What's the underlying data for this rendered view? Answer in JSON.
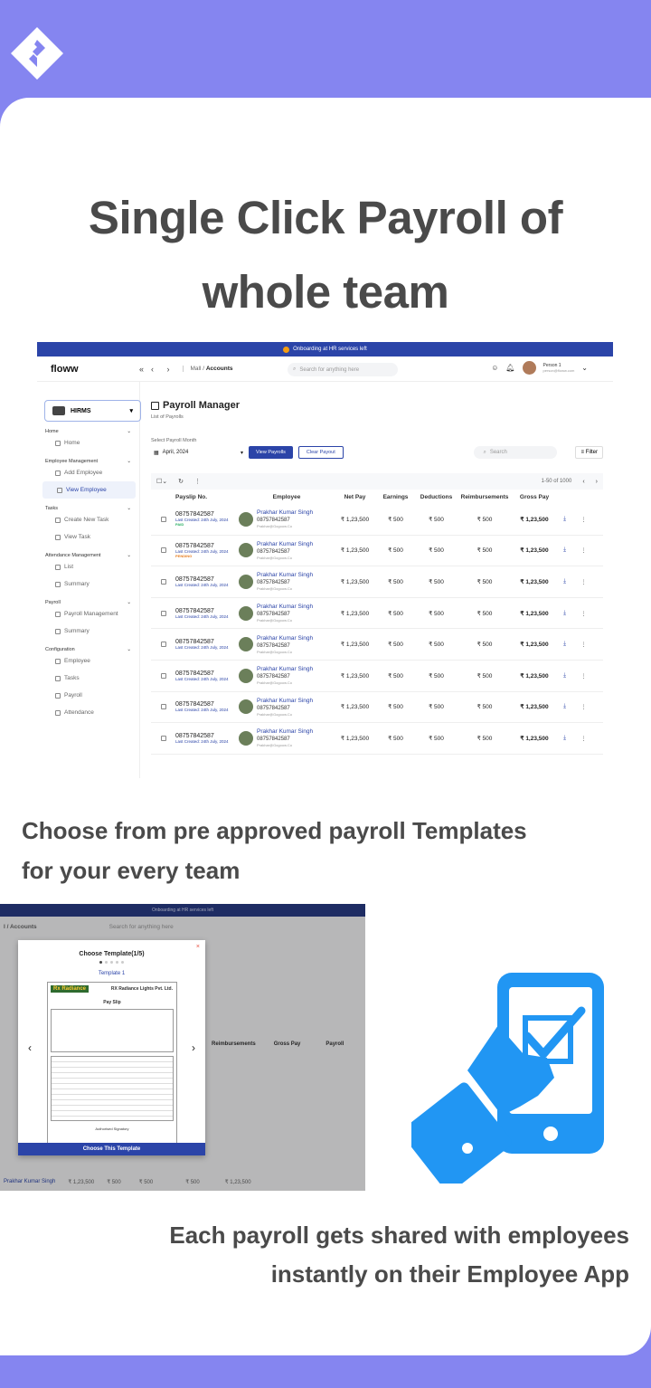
{
  "headline": {
    "line1": "Single Click Payroll of",
    "line2": "whole team"
  },
  "app": {
    "banner": "Onboarding at HR services left",
    "brand": "floww",
    "collapse_icon": "«",
    "nav_arrows": "‹ ›",
    "breadcrumb_prefix": "Mall /",
    "breadcrumb_current": "Accounts",
    "search_placeholder": "Search for anything here",
    "user_name": "Person 1",
    "user_email": "person@floww.com",
    "org": "HIRMS",
    "sidebar": {
      "sections": [
        {
          "title": "Home",
          "items": [
            "Home"
          ]
        },
        {
          "title": "Employee Management",
          "items": [
            "Add Employee",
            "View Employee"
          ]
        },
        {
          "title": "Tasks",
          "items": [
            "Create New Task",
            "View Task"
          ]
        },
        {
          "title": "Attendance Management",
          "items": [
            "List",
            "Summary"
          ]
        },
        {
          "title": "Payroll",
          "items": [
            "Payroll Management",
            "Summary"
          ]
        },
        {
          "title": "Configuration",
          "items": [
            "Employee",
            "Tasks",
            "Payroll",
            "Attendance"
          ]
        }
      ]
    },
    "page_title": "Payroll Manager",
    "page_subtitle": "List of Payrolls",
    "select_label": "Select Payroll Month",
    "month_value": "April, 2024",
    "view_btn": "View Payrolls",
    "clear_btn": "Clear Payout",
    "search2": "Search",
    "filter": "Filter",
    "pagination": "1-50 of 1000",
    "columns": [
      "Payslip No.",
      "Employee",
      "Net Pay",
      "Earnings",
      "Deductions",
      "Reimbursements",
      "Gross Pay"
    ],
    "rows": [
      {
        "slip": "08757842587",
        "created": "Last Created: 24th July, 2024",
        "status": "PAID",
        "status_type": "paid",
        "name": "Prakhar Kumar Singh",
        "phone": "08757842587",
        "email": "Prakhar@Gogoow.Co",
        "net": "₹ 1,23,500",
        "earn": "₹ 500",
        "ded": "₹ 500",
        "reimb": "₹ 500",
        "gross": "₹ 1,23,500"
      },
      {
        "slip": "08757842587",
        "created": "Last Created: 24th July, 2024",
        "status": "PENDING",
        "status_type": "pending",
        "name": "Prakhar Kumar Singh",
        "phone": "08757842587",
        "email": "Prakhar@Gogoow.Co",
        "net": "₹ 1,23,500",
        "earn": "₹ 500",
        "ded": "₹ 500",
        "reimb": "₹ 500",
        "gross": "₹ 1,23,500"
      },
      {
        "slip": "08757842587",
        "created": "Last Created: 24th July, 2024",
        "status": "",
        "status_type": "",
        "name": "Prakhar Kumar Singh",
        "phone": "08757842587",
        "email": "Prakhar@Gogoow.Co",
        "net": "₹ 1,23,500",
        "earn": "₹ 500",
        "ded": "₹ 500",
        "reimb": "₹ 500",
        "gross": "₹ 1,23,500"
      },
      {
        "slip": "08757842587",
        "created": "Last Created: 24th July, 2024",
        "status": "",
        "status_type": "",
        "name": "Prakhar Kumar Singh",
        "phone": "08757842587",
        "email": "Prakhar@Gogoow.Co",
        "net": "₹ 1,23,500",
        "earn": "₹ 500",
        "ded": "₹ 500",
        "reimb": "₹ 500",
        "gross": "₹ 1,23,500"
      },
      {
        "slip": "08757842587",
        "created": "Last Created: 24th July, 2024",
        "status": "",
        "status_type": "",
        "name": "Prakhar Kumar Singh",
        "phone": "08757842587",
        "email": "Prakhar@Gogoow.Co",
        "net": "₹ 1,23,500",
        "earn": "₹ 500",
        "ded": "₹ 500",
        "reimb": "₹ 500",
        "gross": "₹ 1,23,500"
      },
      {
        "slip": "08757842587",
        "created": "Last Created: 24th July, 2024",
        "status": "",
        "status_type": "",
        "name": "Prakhar Kumar Singh",
        "phone": "08757842587",
        "email": "Prakhar@Gogoow.Co",
        "net": "₹ 1,23,500",
        "earn": "₹ 500",
        "ded": "₹ 500",
        "reimb": "₹ 500",
        "gross": "₹ 1,23,500"
      },
      {
        "slip": "08757842587",
        "created": "Last Created: 24th July, 2024",
        "status": "",
        "status_type": "",
        "name": "Prakhar Kumar Singh",
        "phone": "08757842587",
        "email": "Prakhar@Gogoow.Co",
        "net": "₹ 1,23,500",
        "earn": "₹ 500",
        "ded": "₹ 500",
        "reimb": "₹ 500",
        "gross": "₹ 1,23,500"
      },
      {
        "slip": "08757842587",
        "created": "Last Created: 24th July, 2024",
        "status": "",
        "status_type": "",
        "name": "Prakhar Kumar Singh",
        "phone": "08757842587",
        "email": "Prakhar@Gogoow.Co",
        "net": "₹ 1,23,500",
        "earn": "₹ 500",
        "ded": "₹ 500",
        "reimb": "₹ 500",
        "gross": "₹ 1,23,500"
      }
    ]
  },
  "section2_line1": "Choose from pre approved payroll Templates",
  "section2_line2": "for your every team",
  "template_modal": {
    "bg_banner": "Onboarding at HR services left",
    "bg_breadcrumb": "l / Accounts",
    "bg_search": "Search for anything here",
    "bg_rows": [
      {
        "name": "Prakhar Kumar Singh",
        "net": "₹ 1,23,500",
        "earn": "₹ 500",
        "ded": "₹ 500",
        "reimb": "₹ 500",
        "gross": "₹ 1,23,500"
      }
    ],
    "bg_headers": [
      "Reimbursements",
      "Gross Pay",
      "Payroll"
    ],
    "title": "Choose Template(1/5)",
    "close": "×",
    "template_name": "Template 1",
    "doc_logo": "Rx Radiance",
    "doc_company": "RX Radiance Lights Pvt. Ltd.",
    "doc_heading": "Pay Slip",
    "doc_footer": "Authorised Signatory",
    "prev": "‹",
    "next": "›",
    "cta": "Choose This Template"
  },
  "section3_line1": "Each payroll gets shared with employees",
  "section3_line2": "instantly on their Employee App",
  "colors": {
    "brand_bg": "#8585f0",
    "primary": "#2b44a8",
    "accent_icon": "#2196f3",
    "heading": "#4a4a4a"
  }
}
